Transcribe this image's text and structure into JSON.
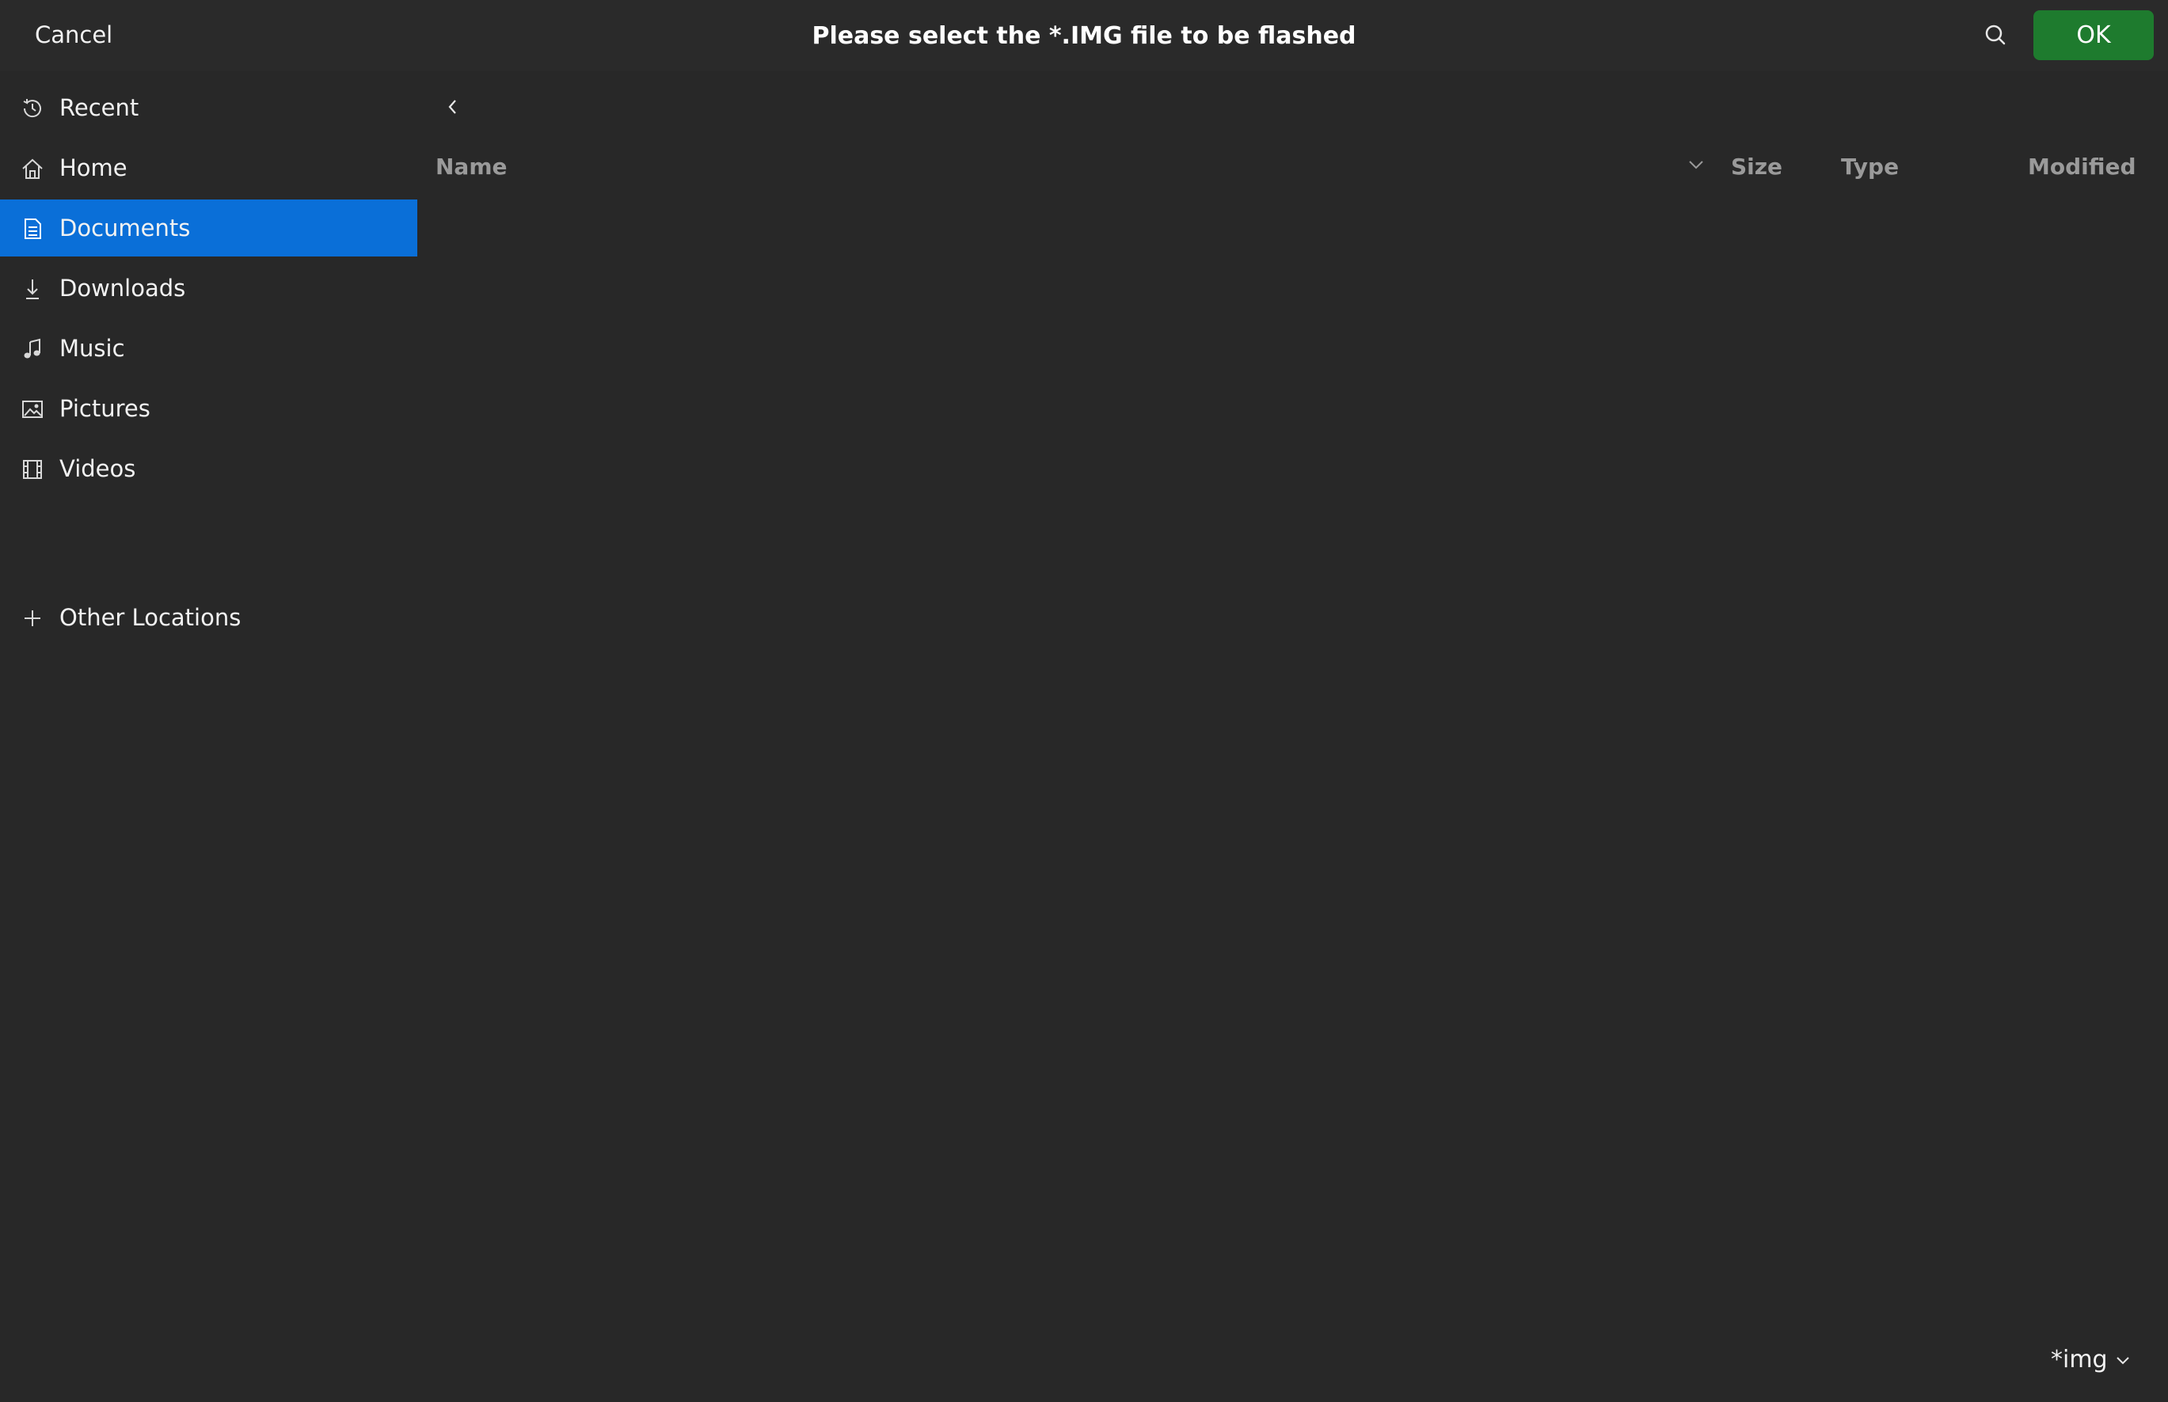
{
  "header": {
    "cancel_label": "Cancel",
    "title": "Please select the *.IMG file to be flashed",
    "ok_label": "OK",
    "search_icon": "search-icon"
  },
  "sidebar": {
    "items": [
      {
        "label": "Recent",
        "icon": "clock-icon"
      },
      {
        "label": "Home",
        "icon": "home-icon"
      },
      {
        "label": "Documents",
        "icon": "document-icon",
        "active": true
      },
      {
        "label": "Downloads",
        "icon": "download-icon"
      },
      {
        "label": "Music",
        "icon": "music-icon"
      },
      {
        "label": "Pictures",
        "icon": "picture-icon"
      },
      {
        "label": "Videos",
        "icon": "video-icon"
      },
      {
        "label": "Other Locations",
        "icon": "plus-icon"
      }
    ]
  },
  "file_list": {
    "columns": [
      "Name",
      "Size",
      "Type",
      "Modified"
    ],
    "rows": []
  },
  "filter": {
    "selected": "*img"
  },
  "colors": {
    "background": "#282828",
    "accent": "#0a6fd8",
    "ok_button": "#1e7b2e",
    "column_header": "#9a9a9a"
  }
}
